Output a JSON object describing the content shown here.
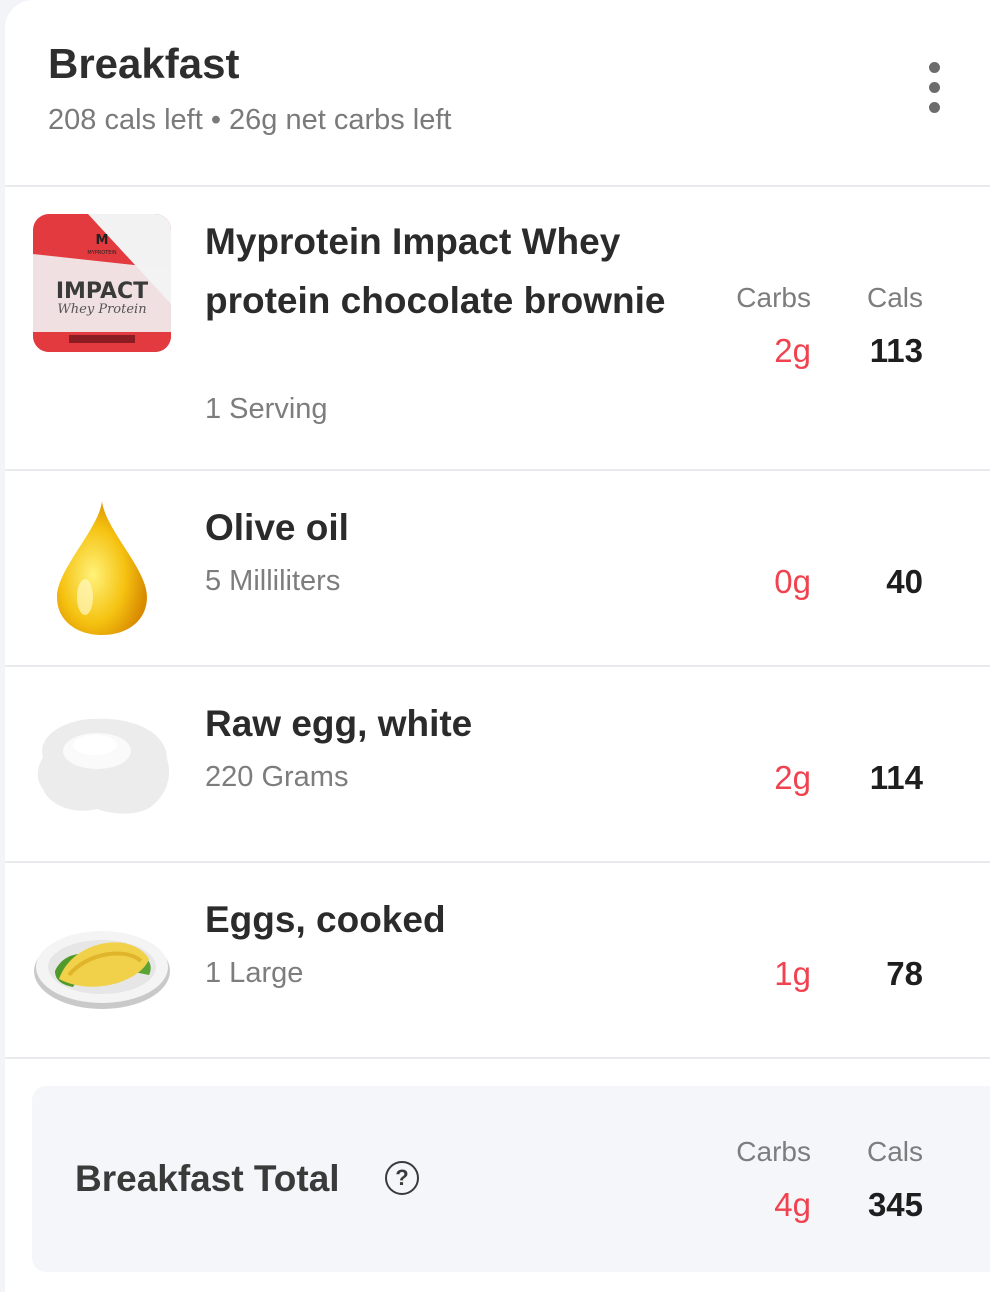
{
  "meal": {
    "title": "Breakfast",
    "subtitle": "208 cals left • 26g net carbs left",
    "menu_icon": "more-vertical-icon"
  },
  "columns": {
    "carbs": "Carbs",
    "cals": "Cals"
  },
  "items": [
    {
      "name": "Myprotein Impact Whey protein chocolate brownie",
      "quantity": "1 Serving",
      "carbs": "2g",
      "cals": "113",
      "image": "protein-pouch-image",
      "package_text": {
        "brand": "MYPROTEIN",
        "product": "IMPACT",
        "subtitle": "Whey Protein"
      }
    },
    {
      "name": "Olive oil",
      "quantity": "5 Milliliters",
      "carbs": "0g",
      "cals": "40",
      "image": "oil-drop-image"
    },
    {
      "name": "Raw egg, white",
      "quantity": "220 Grams",
      "carbs": "2g",
      "cals": "114",
      "image": "egg-white-image"
    },
    {
      "name": "Eggs, cooked",
      "quantity": "1 Large",
      "carbs": "1g",
      "cals": "78",
      "image": "omelette-plate-image"
    }
  ],
  "total": {
    "label": "Breakfast Total",
    "help_icon": "help-circle-icon",
    "help_glyph": "?",
    "carbs": "4g",
    "cals": "345"
  },
  "colors": {
    "carbs": "#f0424f",
    "divider": "#e9eaee",
    "total_bg": "#f4f6f9"
  }
}
